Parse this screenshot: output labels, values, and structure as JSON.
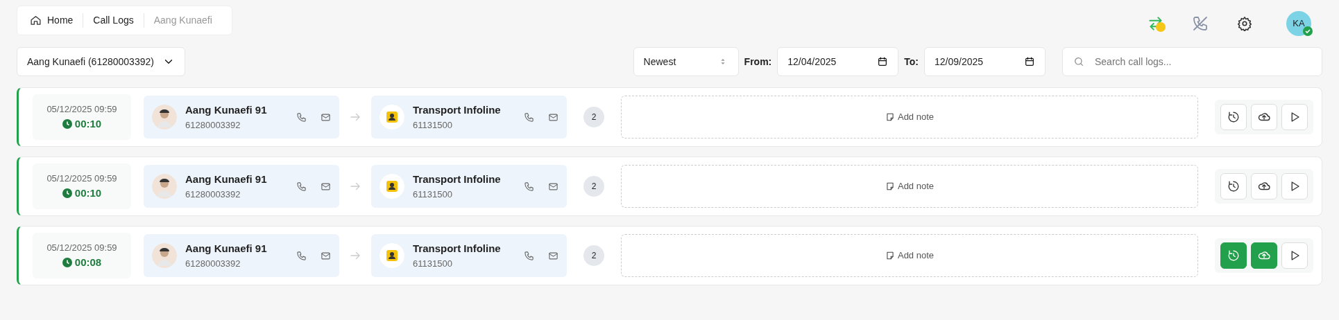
{
  "breadcrumb": [
    {
      "label": "Home",
      "kind": "home",
      "current": false
    },
    {
      "label": "Call Logs",
      "kind": "link",
      "current": false
    },
    {
      "label": "Aang Kunaefi",
      "kind": "link",
      "current": true
    }
  ],
  "header_icons": [
    {
      "kind": "transfer",
      "color": "#f5c518"
    },
    {
      "kind": "phone-off"
    },
    {
      "kind": "settings"
    }
  ],
  "user": {
    "initials": "KA",
    "verified": true
  },
  "filters": {
    "agent": "Aang Kunaefi (61280003392)",
    "sort": "Newest",
    "from_label": "From:",
    "from": "12/04/2025",
    "to_label": "To:",
    "to": "12/09/2025",
    "search": {
      "placeholder": "Search call logs..."
    }
  },
  "calls": [
    {
      "datetime": "05/12/2025 09:59",
      "duration": "00:10",
      "caller": {
        "name": "Aang Kunaefi 91",
        "number": "61280003392"
      },
      "callee": {
        "name": "Transport Infoline",
        "number": "61131500"
      },
      "count": "2",
      "note": "Add note",
      "actions": [
        {
          "kind": "history",
          "active": false
        },
        {
          "kind": "upload",
          "active": false
        },
        {
          "kind": "play",
          "active": false
        }
      ]
    },
    {
      "datetime": "05/12/2025 09:59",
      "duration": "00:10",
      "caller": {
        "name": "Aang Kunaefi 91",
        "number": "61280003392"
      },
      "callee": {
        "name": "Transport Infoline",
        "number": "61131500"
      },
      "count": "2",
      "note": "Add note",
      "actions": [
        {
          "kind": "history",
          "active": false
        },
        {
          "kind": "upload",
          "active": false
        },
        {
          "kind": "play",
          "active": false
        }
      ]
    },
    {
      "datetime": "05/12/2025 09:59",
      "duration": "00:08",
      "caller": {
        "name": "Aang Kunaefi 91",
        "number": "61280003392"
      },
      "callee": {
        "name": "Transport Infoline",
        "number": "61131500"
      },
      "count": "2",
      "note": "Add note",
      "actions": [
        {
          "kind": "history",
          "active": true
        },
        {
          "kind": "upload",
          "active": true
        },
        {
          "kind": "play",
          "active": false
        }
      ]
    }
  ]
}
